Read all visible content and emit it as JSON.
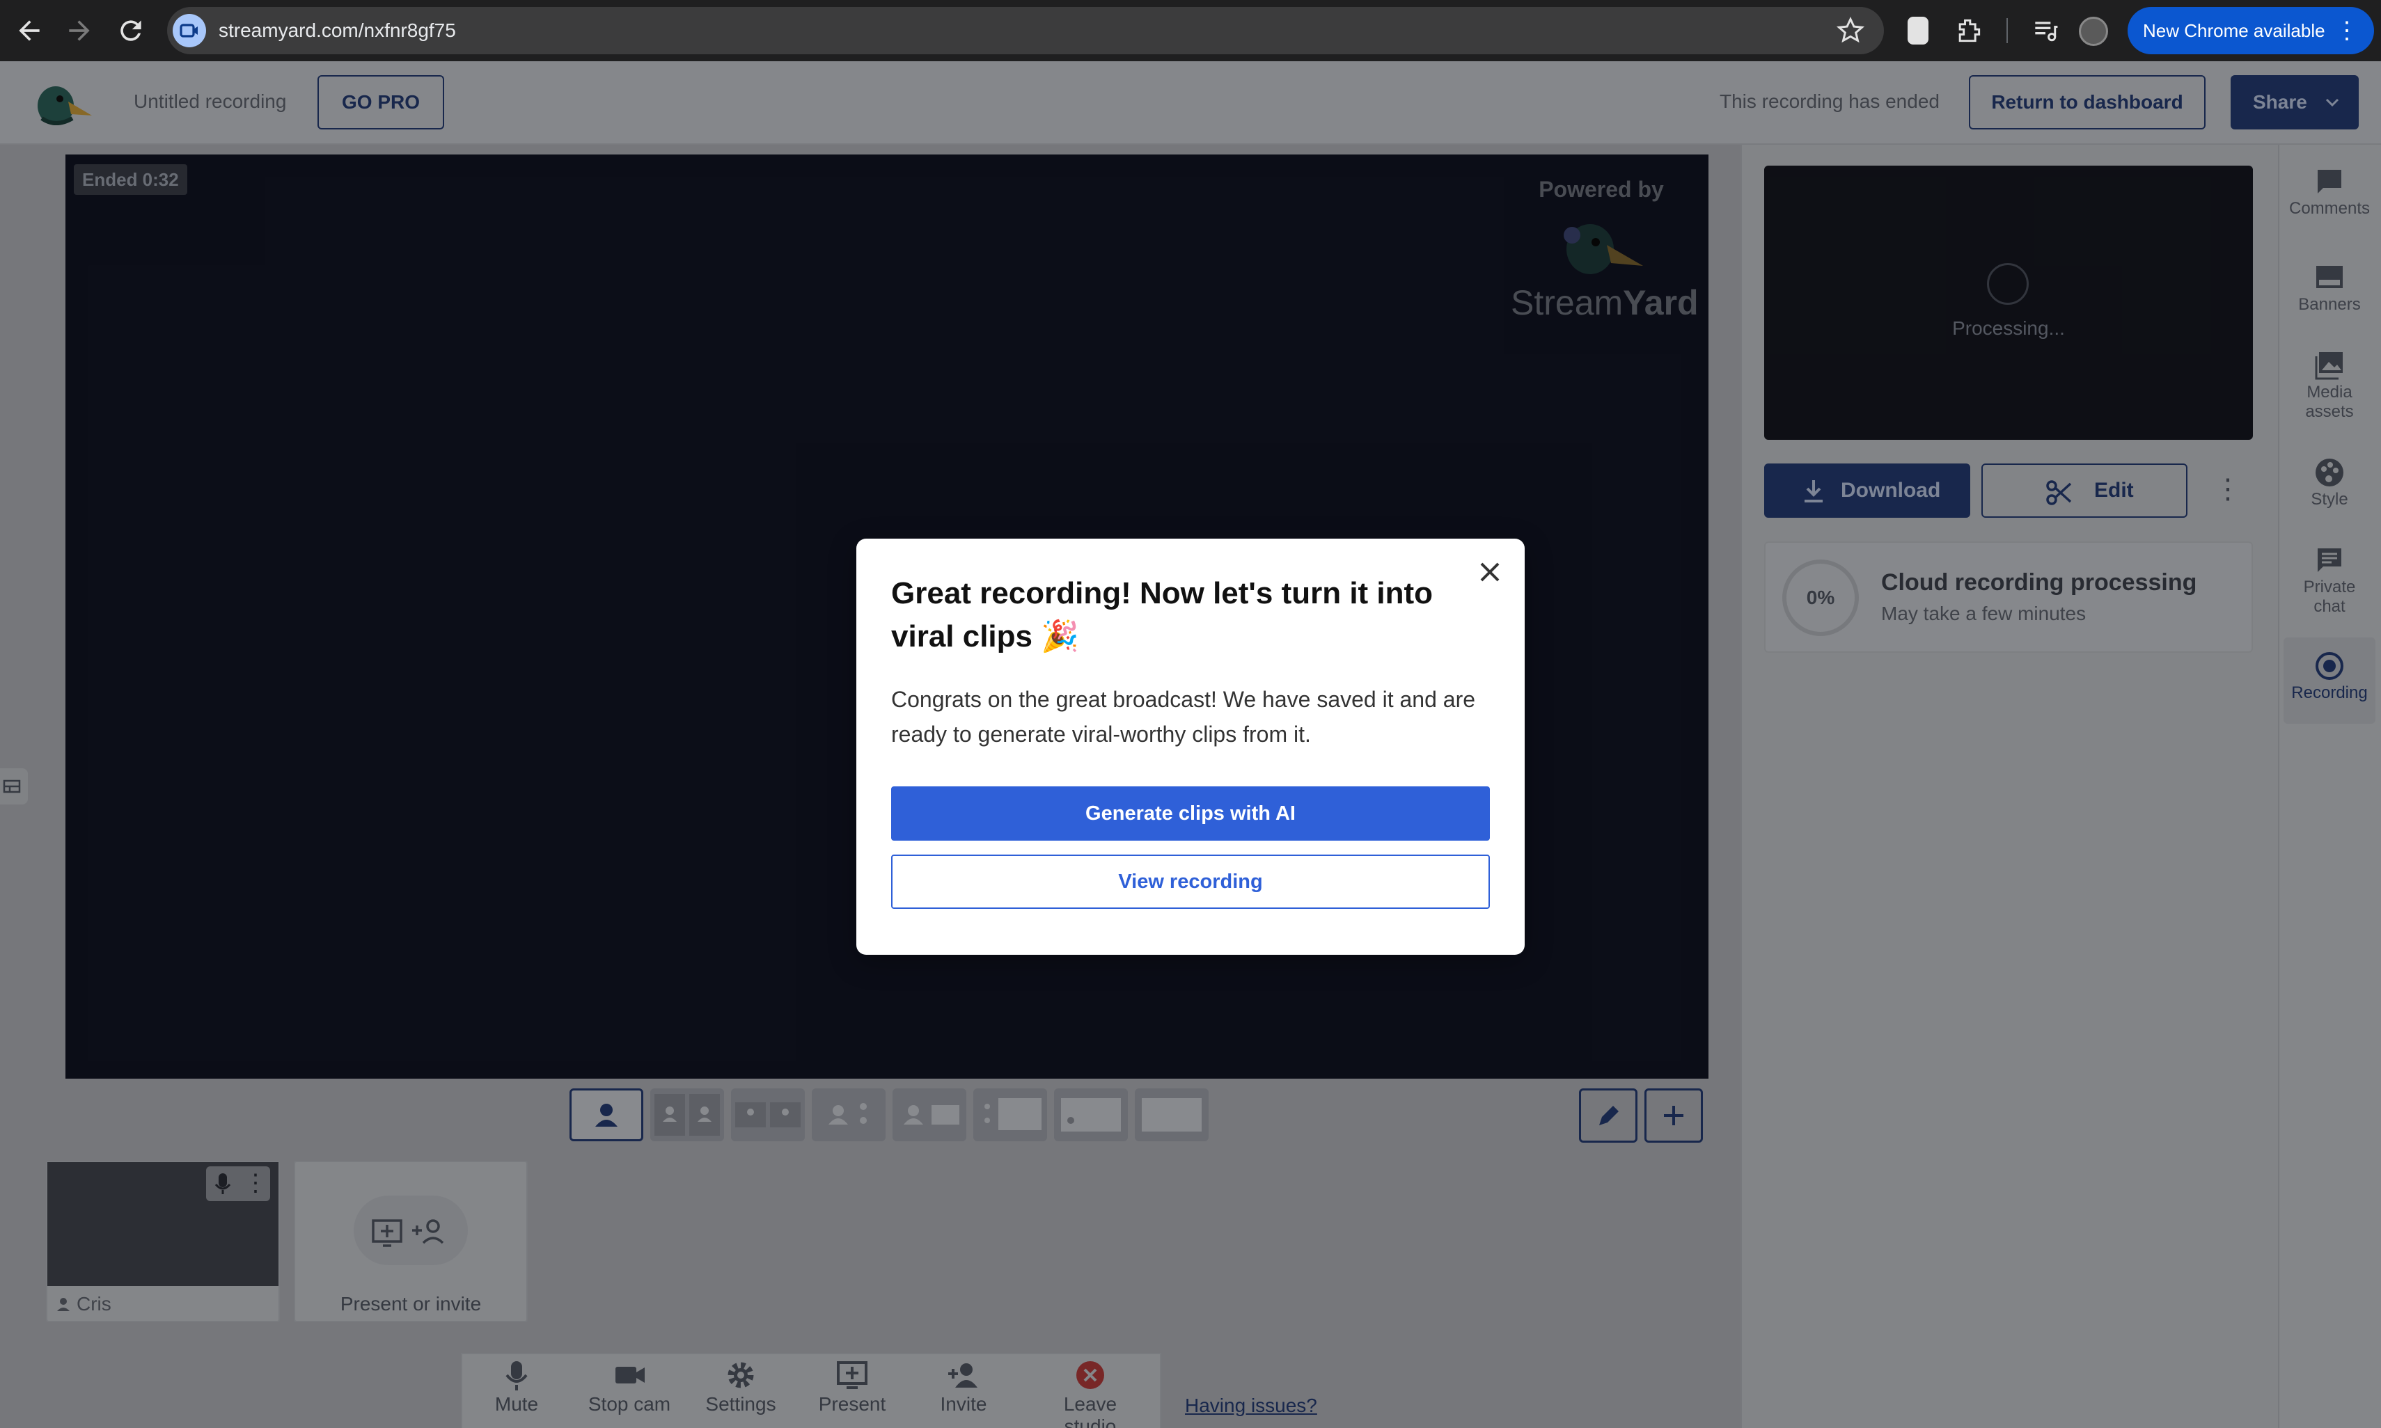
{
  "browser": {
    "url": "streamyard.com/nxfnr8gf75",
    "new_chrome_label": "New Chrome available"
  },
  "header": {
    "title": "Untitled recording",
    "go_pro_label": "GO PRO",
    "status_text": "This recording has ended",
    "return_label": "Return to dashboard",
    "share_label": "Share"
  },
  "stage": {
    "ended_badge": "Ended 0:32",
    "powered_by": "Powered by",
    "brand_name_light": "Stream",
    "brand_name_bold": "Yard"
  },
  "modal": {
    "title": "Great recording! Now let's turn it into viral clips 🎉",
    "body": "Congrats on the great broadcast! We have saved it and are ready to generate viral-worthy clips from it.",
    "primary_label": "Generate clips with AI",
    "secondary_label": "View recording"
  },
  "recording_panel": {
    "processing_label": "Processing...",
    "download_label": "Download",
    "edit_label": "Edit",
    "progress_percent": "0%",
    "progress_title": "Cloud recording processing",
    "progress_subtitle": "May take a few minutes"
  },
  "rail": {
    "items": [
      {
        "label": "Comments",
        "icon": "comment-icon"
      },
      {
        "label": "Banners",
        "icon": "banner-icon"
      },
      {
        "label": "Media assets",
        "icon": "image-icon"
      },
      {
        "label": "Style",
        "icon": "palette-icon"
      },
      {
        "label": "Private chat",
        "icon": "chat-icon"
      },
      {
        "label": "Recording",
        "icon": "record-icon"
      }
    ]
  },
  "participants": {
    "guest_name": "Cris",
    "present_label": "Present or invite"
  },
  "controls": {
    "items": [
      {
        "label": "Mute",
        "icon": "mic-icon"
      },
      {
        "label": "Stop cam",
        "icon": "camera-icon"
      },
      {
        "label": "Settings",
        "icon": "gear-icon"
      },
      {
        "label": "Present",
        "icon": "present-icon"
      },
      {
        "label": "Invite",
        "icon": "add-person-icon"
      },
      {
        "label": "Leave studio",
        "icon": "leave-icon"
      }
    ],
    "help_link": "Having issues?"
  },
  "colors": {
    "primary": "#2f60d8",
    "navy": "#243a70",
    "stage_bg": "#111423",
    "leave_red": "#c73030"
  }
}
